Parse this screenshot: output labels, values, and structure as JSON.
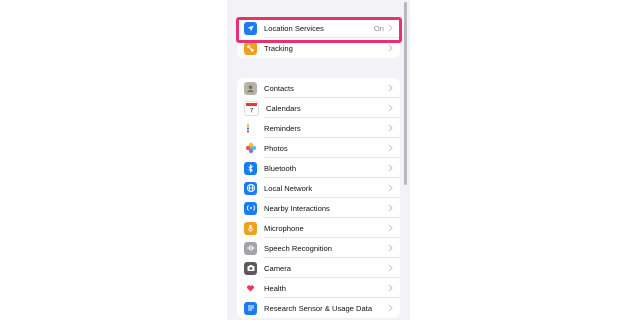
{
  "privacy_list": {
    "group1": [
      {
        "label": "Location Services",
        "value": "On",
        "icon": "location-arrow-icon",
        "color": "#1a7cf5"
      },
      {
        "label": "Tracking",
        "value": "",
        "icon": "tracking-icon",
        "color": "#f2a01c"
      }
    ],
    "group2": [
      {
        "label": "Contacts",
        "icon": "contacts-icon",
        "color": "#b8b3a8"
      },
      {
        "label": "Calendars",
        "icon": "calendar-icon",
        "color": "#ffffff"
      },
      {
        "label": "Reminders",
        "icon": "reminders-icon",
        "color": "#ffffff"
      },
      {
        "label": "Photos",
        "icon": "photos-icon",
        "color": "#ffffff"
      },
      {
        "label": "Bluetooth",
        "icon": "bluetooth-icon",
        "color": "#1a7cf5"
      },
      {
        "label": "Local Network",
        "icon": "globe-icon",
        "color": "#1a7cf5"
      },
      {
        "label": "Nearby Interactions",
        "icon": "nearby-icon",
        "color": "#1a7cf5"
      },
      {
        "label": "Microphone",
        "icon": "microphone-icon",
        "color": "#f2a01c"
      },
      {
        "label": "Speech Recognition",
        "icon": "waveform-icon",
        "color": "#a3a3a8"
      },
      {
        "label": "Camera",
        "icon": "camera-icon",
        "color": "#5a5a5e"
      },
      {
        "label": "Health",
        "icon": "heart-icon",
        "color": "#ffffff"
      },
      {
        "label": "Research Sensor & Usage Data",
        "icon": "research-icon",
        "color": "#1a7cf5"
      }
    ]
  },
  "highlight_color": "#e8316f"
}
